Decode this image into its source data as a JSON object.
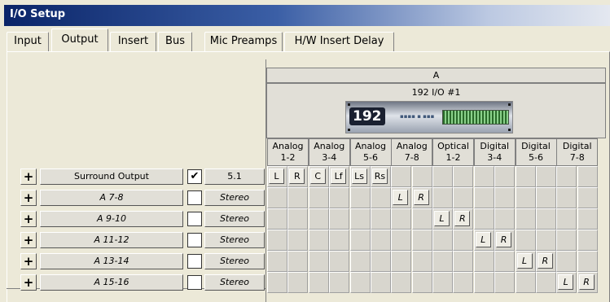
{
  "window": {
    "title": "I/O Setup"
  },
  "tabs": [
    {
      "label": "Input",
      "active": false
    },
    {
      "label": "Output",
      "active": true
    },
    {
      "label": "Insert",
      "active": false
    },
    {
      "label": "Bus",
      "active": false
    },
    {
      "label": "Mic Preamps",
      "active": false
    },
    {
      "label": "H/W Insert Delay",
      "active": false
    }
  ],
  "header": {
    "group": "A",
    "device_name": "192 I/O #1",
    "device_badge": "192",
    "ports": [
      {
        "line1": "Analog",
        "line2": "1-2"
      },
      {
        "line1": "Analog",
        "line2": "3-4"
      },
      {
        "line1": "Analog",
        "line2": "5-6"
      },
      {
        "line1": "Analog",
        "line2": "7-8"
      },
      {
        "line1": "Optical",
        "line2": "1-2"
      },
      {
        "line1": "Digital",
        "line2": "3-4"
      },
      {
        "line1": "Digital",
        "line2": "5-6"
      },
      {
        "line1": "Digital",
        "line2": "7-8"
      }
    ]
  },
  "rows": [
    {
      "name": "Surround Output",
      "checked": true,
      "format": "5.1",
      "italic": false,
      "plus": "+"
    },
    {
      "name": "A 7-8",
      "checked": false,
      "format": "Stereo",
      "italic": true,
      "plus": "+"
    },
    {
      "name": "A 9-10",
      "checked": false,
      "format": "Stereo",
      "italic": true,
      "plus": "+"
    },
    {
      "name": "A 11-12",
      "checked": false,
      "format": "Stereo",
      "italic": true,
      "plus": "+"
    },
    {
      "name": "A 13-14",
      "checked": false,
      "format": "Stereo",
      "italic": true,
      "plus": "+"
    },
    {
      "name": "A 15-16",
      "checked": false,
      "format": "Stereo",
      "italic": true,
      "plus": "+"
    }
  ],
  "check_mark": "✔",
  "assignments": [
    {
      "row": 0,
      "col": 0,
      "label": "L"
    },
    {
      "row": 0,
      "col": 1,
      "label": "R"
    },
    {
      "row": 0,
      "col": 2,
      "label": "C"
    },
    {
      "row": 0,
      "col": 3,
      "label": "Lf"
    },
    {
      "row": 0,
      "col": 4,
      "label": "Ls"
    },
    {
      "row": 0,
      "col": 5,
      "label": "Rs"
    },
    {
      "row": 1,
      "col": 6,
      "label": "L"
    },
    {
      "row": 1,
      "col": 7,
      "label": "R"
    },
    {
      "row": 2,
      "col": 8,
      "label": "L"
    },
    {
      "row": 2,
      "col": 9,
      "label": "R"
    },
    {
      "row": 3,
      "col": 10,
      "label": "L"
    },
    {
      "row": 3,
      "col": 11,
      "label": "R"
    },
    {
      "row": 4,
      "col": 12,
      "label": "L"
    },
    {
      "row": 4,
      "col": 13,
      "label": "R"
    },
    {
      "row": 5,
      "col": 14,
      "label": "L"
    },
    {
      "row": 5,
      "col": 15,
      "label": "R"
    }
  ]
}
